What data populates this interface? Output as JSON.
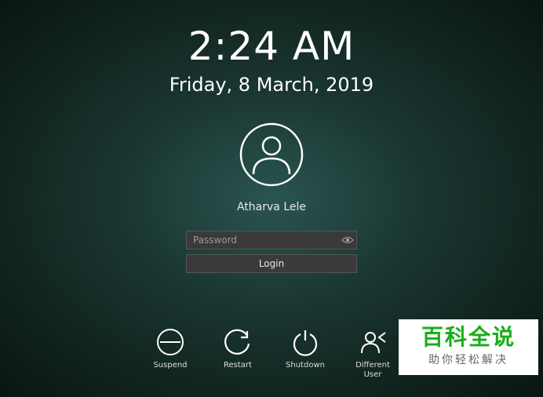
{
  "clock": {
    "time": "2:24 AM",
    "date": "Friday, 8 March, 2019"
  },
  "user": {
    "name": "Atharva Lele"
  },
  "form": {
    "password_placeholder": "Password",
    "login_label": "Login"
  },
  "actions": {
    "suspend": "Suspend",
    "restart": "Restart",
    "shutdown": "Shutdown",
    "different_user": "Different\nUser"
  },
  "watermark": {
    "title": "百科全说",
    "subtitle": "助你轻松解决"
  }
}
